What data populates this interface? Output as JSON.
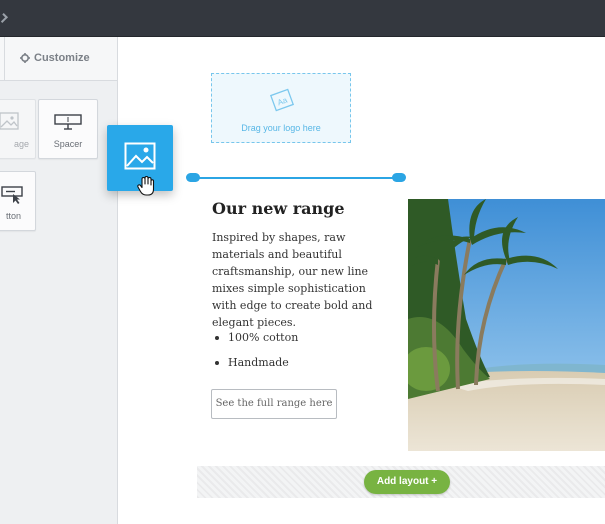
{
  "sidebar": {
    "customize_tab": "Customize",
    "tiles": [
      {
        "label": "age",
        "icon": "image-icon"
      },
      {
        "label": "Spacer",
        "icon": "spacer-icon"
      },
      {
        "label": "tton",
        "icon": "button-icon"
      }
    ]
  },
  "drag_block": {
    "icon": "image-icon"
  },
  "canvas": {
    "logo_drop": "Drag your logo here",
    "title": "Our new range",
    "body": "Inspired by shapes, raw materials and beautiful craftsmanship, our new line mixes simple sophistication with edge to create bold and elegant pieces.",
    "bullets": [
      "100% cotton",
      "Handmade"
    ],
    "cta": "See the full range here",
    "add_layout": "Add layout  +"
  },
  "colors": {
    "accent_blue": "#29a8e9",
    "add_green": "#78b342",
    "topbar": "#34383f"
  }
}
